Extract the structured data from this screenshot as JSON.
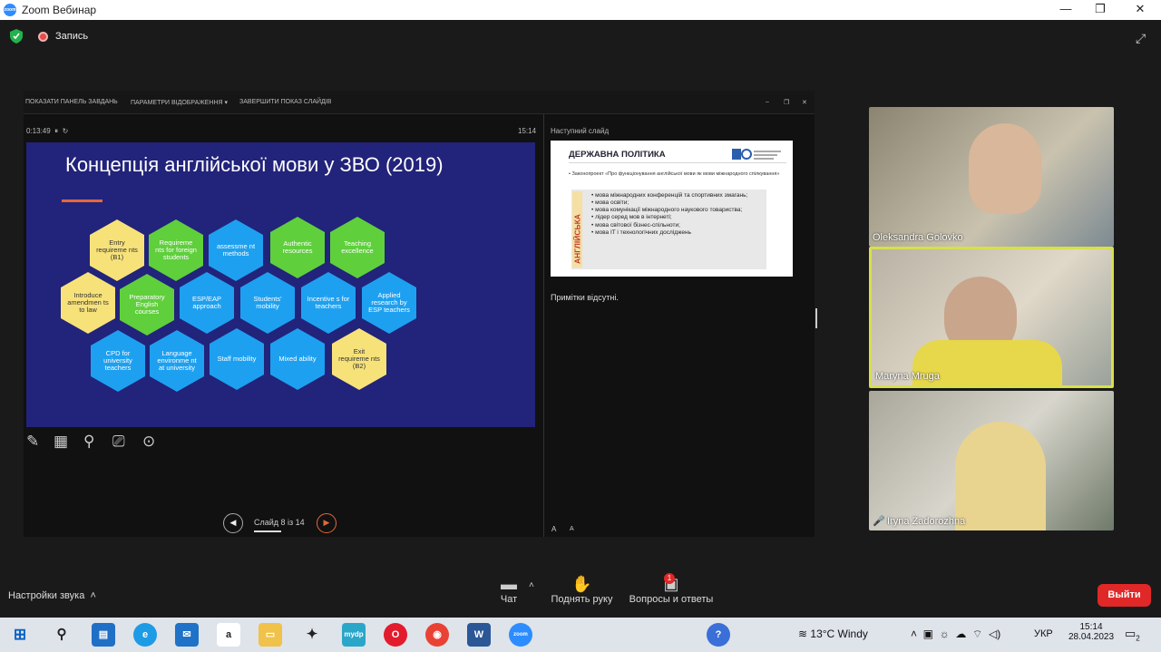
{
  "window": {
    "title": "Zoom Вебинар",
    "minimize": "—",
    "maximize": "❐",
    "close": "✕"
  },
  "recording": {
    "label": "Запись"
  },
  "presenter": {
    "toolbar": {
      "taskbar_label": "ПОКАЗАТИ ПАНЕЛЬ ЗАВДАНЬ",
      "display_label": "ПАРАМЕТРИ ВІДОБРАЖЕННЯ ▾",
      "end_label": "ЗАВЕРШИТИ ПОКАЗ СЛАЙДІВ",
      "win_min": "–",
      "win_restore": "❐",
      "win_close": "✕"
    },
    "elapsed": "0:13:49",
    "clock": "15:14",
    "slide_title": "Концепція англійської мови у ЗВО (2019)",
    "hexes": [
      "Entry requireme nts (B1)",
      "Requireme nts for foreign students",
      "assessme nt methods",
      "Authentic resources",
      "Teaching excellence",
      "Introduce amendmen ts to law",
      "Preparatory English courses",
      "ESP/EAP approach",
      "Students' mobility",
      "Incentive s for teachers",
      "Applied research by ESP teachers",
      "CPD for university teachers",
      "Language environme nt at university",
      "Staff mobility",
      "Mixed ability",
      "Exit requireme nts (B2)"
    ],
    "next_slide_label": "Наступний слайд",
    "next_slide": {
      "title": "ДЕРЖАВНА ПОЛІТИКА",
      "intro": "• Законопроект «Про функціонування англійської мови як мови міжнародного спілкування»",
      "vertical": "АНГЛІЙСЬКА",
      "items": [
        "• мова міжнародних конференцій та спортивних змагань;",
        "• мова освіти;",
        "• мова комунікації міжнародного наукового товариства;",
        "• лідер серед мов в інтернеті;",
        "• мова світової бізнес-спільноти;",
        "• мова IT і технологічних досліджень"
      ]
    },
    "notes": "Примітки відсутні.",
    "nav": {
      "label": "Слайд 8 із 14",
      "prev": "◀",
      "next": "▶"
    },
    "font_controls": [
      "A",
      "A"
    ]
  },
  "participants": [
    {
      "name": "Oleksandra Golovko"
    },
    {
      "name": "Maryna Mruga"
    },
    {
      "name": "Iryna Zadorozhna"
    }
  ],
  "controls": {
    "sound_settings": "Настройки звука",
    "chat": "Чат",
    "raise_hand": "Поднять руку",
    "qa": "Вопросы и ответы",
    "qa_badge": "1",
    "exit": "Выйти"
  },
  "taskbar": {
    "weather": "13°C  Windy",
    "lang": "УКР",
    "time": "15:14",
    "date": "28.04.2023",
    "notif_count": "2"
  },
  "colors": {
    "slide_bg": "#22237a",
    "hex_yellow": "#f7e27a",
    "hex_green": "#5fcf3c",
    "hex_blue": "#1ea0f0",
    "exit": "#e02828"
  }
}
